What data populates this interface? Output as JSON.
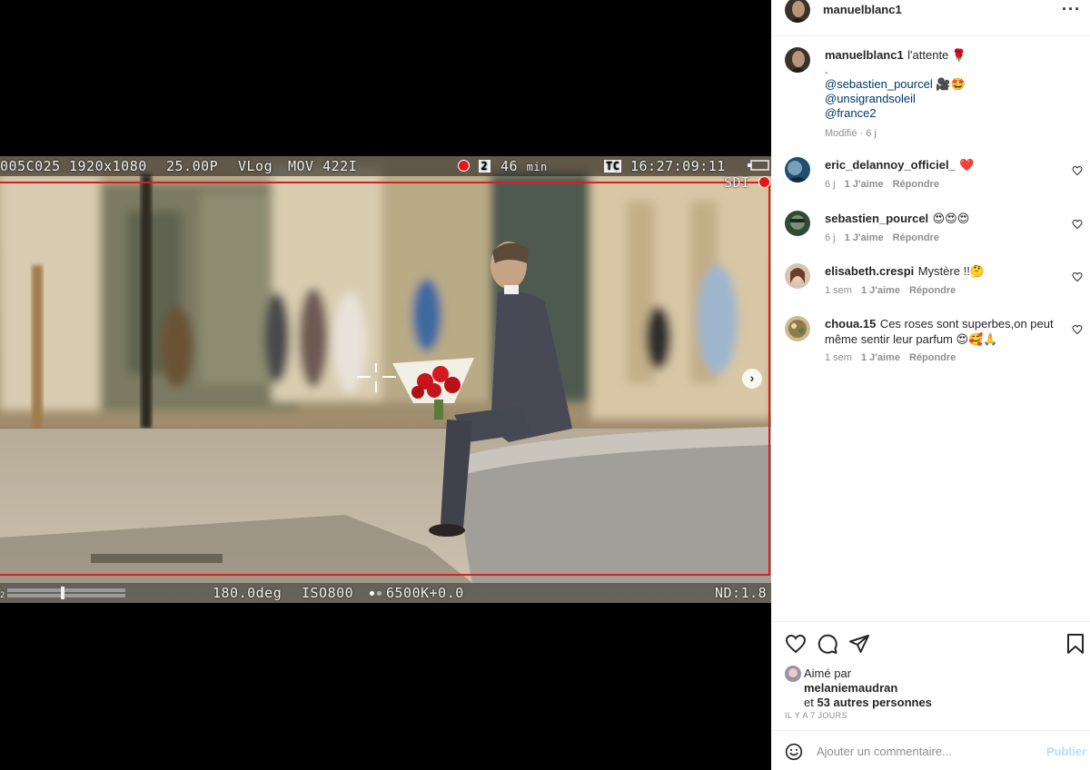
{
  "media": {
    "osd_top": {
      "clip": "005C025",
      "resolution": "1920x1080",
      "fps": "25.00P",
      "gamma": "VLog",
      "codec": "MOV 422I",
      "rec_slot": "2",
      "remaining": "46",
      "remaining_unit": "min",
      "tc_label": "TC",
      "timecode": "16:27:09:11",
      "sdi": "SDI"
    },
    "osd_bottom": {
      "shutter": "180.0deg",
      "iso": "ISO800",
      "white_balance": "6500K+0.0",
      "nd": "ND:1.8"
    },
    "carousel_index": 1,
    "carousel_count": 2
  },
  "post": {
    "author": "manuelblanc1",
    "caption": {
      "author": "manuelblanc1",
      "text": "l'attente 🌹",
      "dot": ".",
      "mentions": [
        "@sebastien_pourcel 🎥🤩",
        "@unsigrandsoleil",
        "@france2"
      ],
      "modified": "Modifié",
      "time": "6 j"
    },
    "more_icon": "more-horizontal-icon"
  },
  "comments": [
    {
      "user": "eric_delannoy_officiel_",
      "text": "❤️",
      "time": "6 j",
      "likes": "1 J'aime",
      "reply": "Répondre",
      "avatar_color": "#1f4f6e"
    },
    {
      "user": "sebastien_pourcel",
      "text": "😍😍😍",
      "time": "6 j",
      "likes": "1 J'aime",
      "reply": "Répondre",
      "avatar_color": "#2f4a35"
    },
    {
      "user": "elisabeth.crespi",
      "text": "Mystère !!🤔",
      "time": "1 sem",
      "likes": "1 J'aime",
      "reply": "Répondre",
      "avatar_color": "#b07a6a"
    },
    {
      "user": "choua.15",
      "text": "Ces roses sont superbes,on peut même sentir leur parfum 😍🥰🙏",
      "time": "1 sem",
      "likes": "1 J'aime",
      "reply": "Répondre",
      "avatar_color": "#8f7a4e"
    }
  ],
  "actions": {
    "icons": [
      "heart-icon",
      "comment-icon",
      "share-icon",
      "bookmark-icon"
    ],
    "liked_by_label": "Aimé par",
    "liked_by_user": "melaniemaudran",
    "others_prefix": "et",
    "others": "53 autres personnes",
    "date": "IL Y A 7 JOURS"
  },
  "add_comment": {
    "placeholder": "Ajouter un commentaire...",
    "publish": "Publier"
  },
  "colors": {
    "link": "#00376b",
    "muted": "#8e8e8e",
    "publish_disabled": "#b2dffc",
    "rec": "#e01818",
    "safe_frame": "#d61f1f"
  }
}
